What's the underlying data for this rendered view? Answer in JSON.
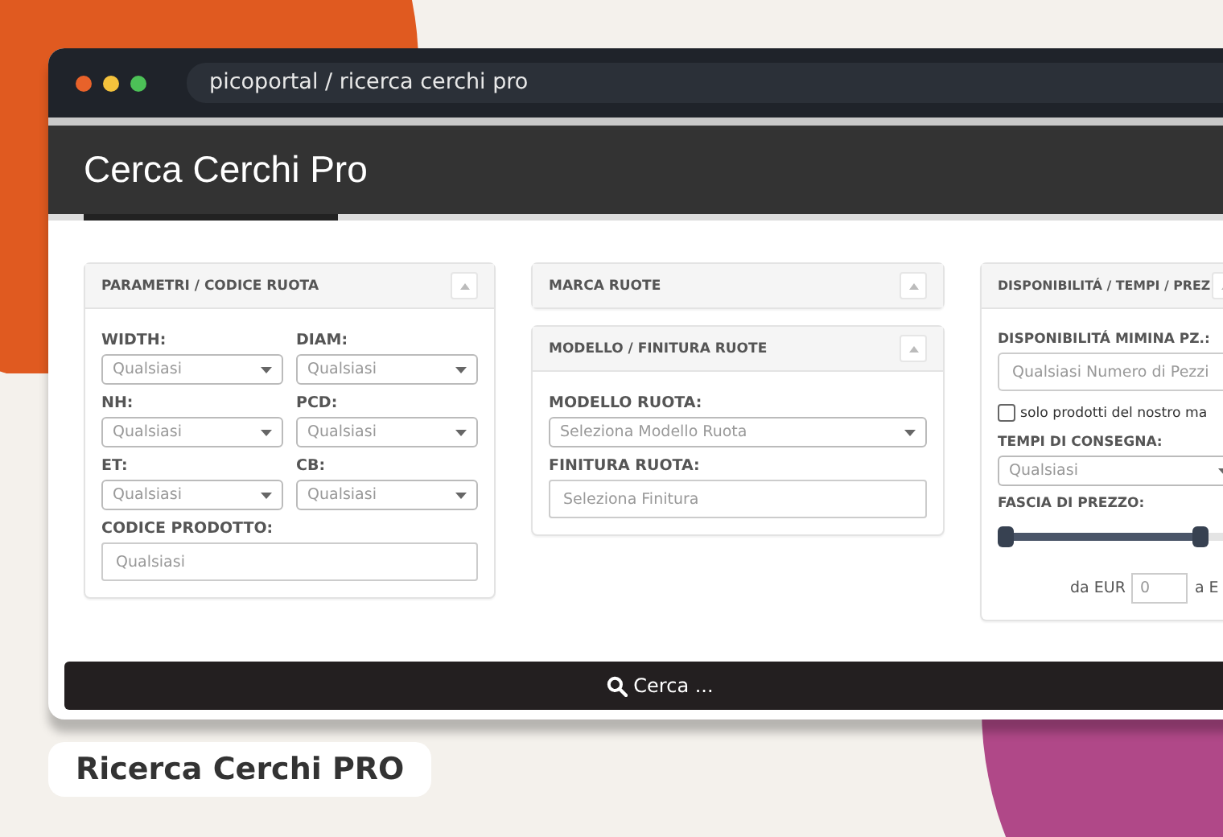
{
  "window": {
    "address": "picoportal / ricerca cerchi pro"
  },
  "header": {
    "title": "Cerca Cerchi Pro"
  },
  "columns": [
    [
      {
        "title": "PARAMETRI / CODICE RUOTA",
        "fields": [
          {
            "kind": "pair",
            "items": [
              {
                "label": "WIDTH:",
                "kind": "select",
                "placeholder": "Qualsiasi"
              },
              {
                "label": "DIAM:",
                "kind": "select",
                "placeholder": "Qualsiasi"
              }
            ]
          },
          {
            "kind": "pair",
            "items": [
              {
                "label": "NH:",
                "kind": "select",
                "placeholder": "Qualsiasi"
              },
              {
                "label": "PCD:",
                "kind": "select",
                "placeholder": "Qualsiasi"
              }
            ]
          },
          {
            "kind": "pair",
            "items": [
              {
                "label": "ET:",
                "kind": "select",
                "placeholder": "Qualsiasi"
              },
              {
                "label": "CB:",
                "kind": "select",
                "placeholder": "Qualsiasi"
              }
            ]
          },
          {
            "kind": "input",
            "label": "CODICE PRODOTTO:",
            "placeholder": "Qualsiasi"
          }
        ]
      }
    ],
    [
      {
        "title": "MARCA RUOTE"
      },
      {
        "title": "MODELLO / FINITURA RUOTE",
        "fields": [
          {
            "kind": "select",
            "label": "MODELLO RUOTA:",
            "placeholder": "Seleziona Modello Ruota"
          },
          {
            "kind": "input",
            "label": "FINITURA RUOTA:",
            "placeholder": "Seleziona Finitura"
          }
        ]
      }
    ],
    [
      {
        "title": "DISPONIBILITÁ / TEMPI / PREZ",
        "fields": [
          {
            "kind": "input",
            "label": "DISPONIBILITÁ MIMINA PZ.:",
            "placeholder": "Qualsiasi Numero di Pezzi"
          },
          {
            "kind": "checkbox",
            "label": "solo prodotti del nostro ma",
            "checked": false
          },
          {
            "kind": "select",
            "label": "TEMPI DI CONSEGNA:",
            "placeholder": "Qualsiasi"
          },
          {
            "kind": "range",
            "label": "FASCIA DI PREZZO:",
            "level": 0.84
          },
          {
            "kind": "price",
            "from_label": "da EUR",
            "value": "0",
            "to_label": "a E"
          }
        ]
      }
    ]
  ],
  "search_button": "Cerca ...",
  "caption": "Ricerca Cerchi PRO"
}
